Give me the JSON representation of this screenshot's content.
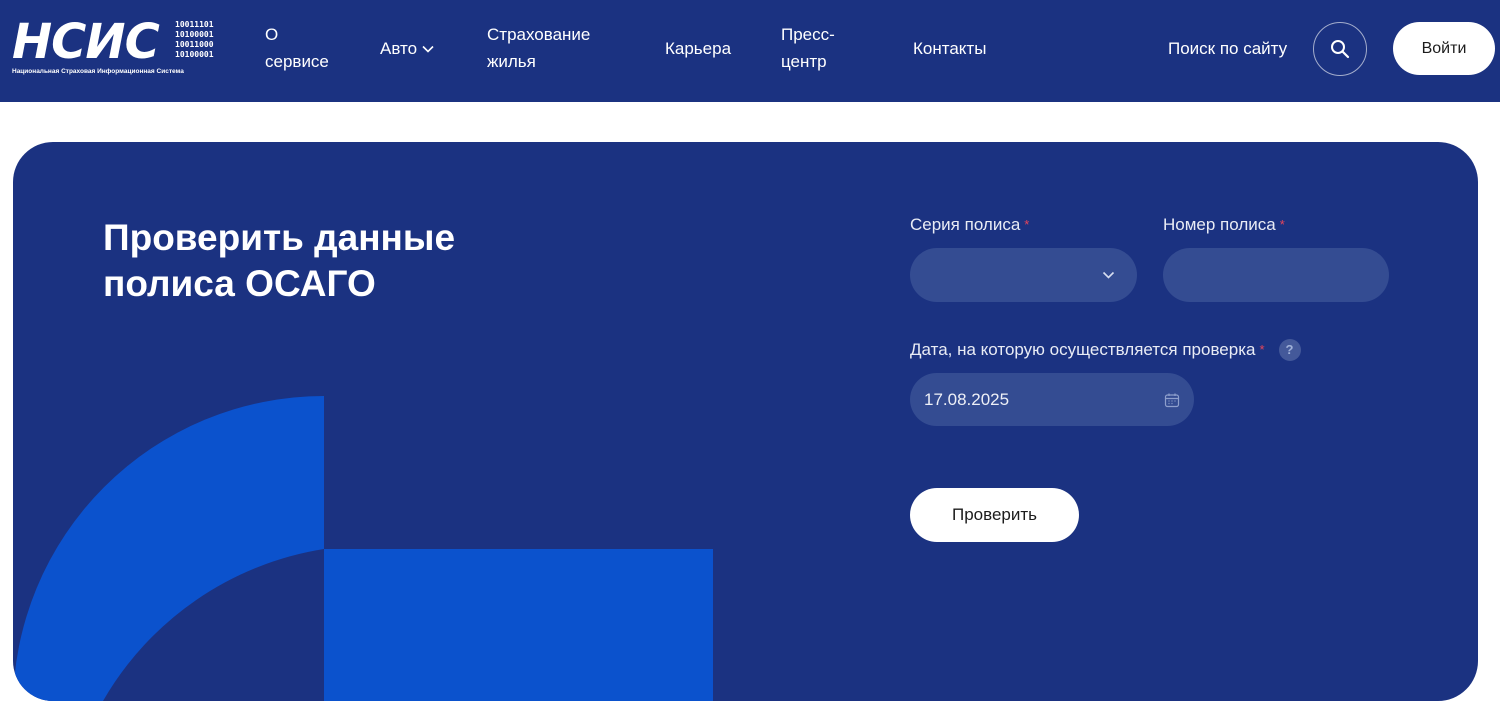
{
  "header": {
    "logo": {
      "main": "НСИС",
      "bits": [
        "10011101",
        "10100001",
        "10011000",
        "10100001"
      ],
      "subtitle": "Национальная Страховая Информационная Система"
    },
    "nav": {
      "about": "О сервисе",
      "auto": "Авто",
      "home_insurance": "Страхование жилья",
      "career": "Карьера",
      "press": "Пресс-центр",
      "contacts": "Контакты"
    },
    "search_label": "Поиск по сайту",
    "login_label": "Войти"
  },
  "form": {
    "title": "Проверить данные полиса ОСАГО",
    "series_label": "Серия полиса",
    "series_value": "",
    "number_label": "Номер полиса",
    "number_value": "",
    "date_label": "Дата, на которую осуществляется проверка",
    "date_value": "17.08.2025",
    "required_mark": "*",
    "help_mark": "?",
    "submit_label": "Проверить"
  },
  "colors": {
    "brand_navy": "#1b3281",
    "field_bg": "#344c92",
    "accent_blue": "#0b52cd",
    "required_red": "#e8455a"
  }
}
